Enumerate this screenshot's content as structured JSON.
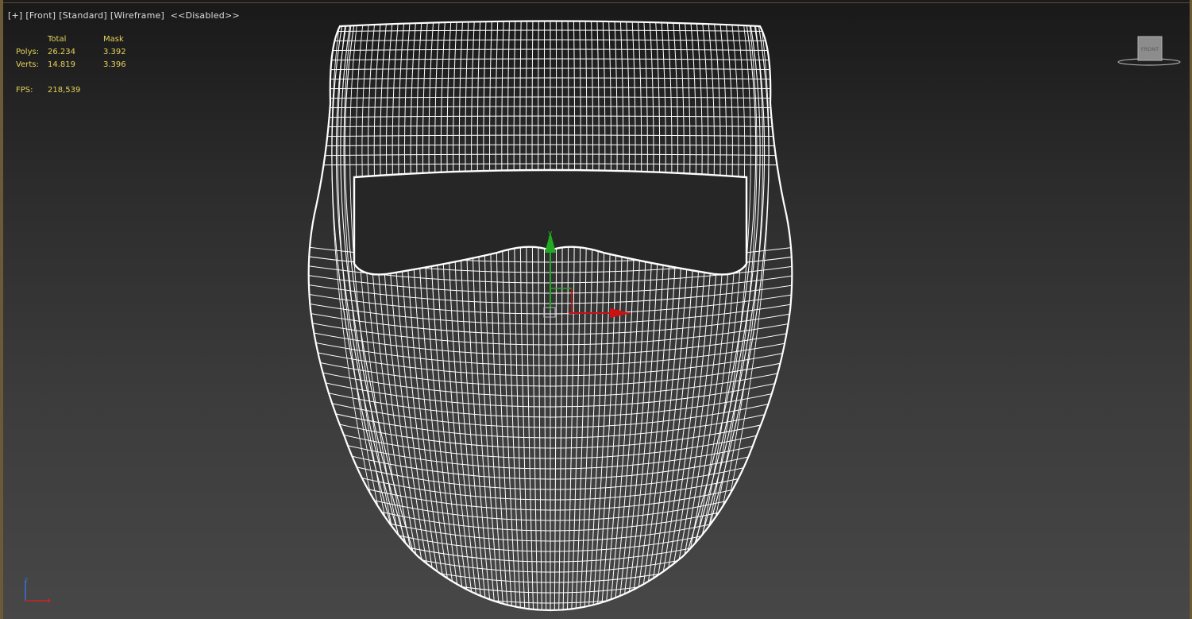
{
  "viewport": {
    "labels": [
      "[+]",
      "[Front]",
      "[Standard]",
      "[Wireframe]",
      "<<Disabled>>"
    ],
    "stats": {
      "header": [
        "",
        "Total",
        "Mask"
      ],
      "rows": [
        {
          "label": "Polys:",
          "total": "26.234",
          "mask": "3.392"
        },
        {
          "label": "Verts:",
          "total": "14.819",
          "mask": "3.396"
        }
      ],
      "fps_label": "FPS:",
      "fps_value": "218,539"
    },
    "viewcube_label": "FRONT",
    "gizmo_y_label": "y",
    "tripod_z_label": "z"
  },
  "colors": {
    "stats_text": "#e6d25a",
    "wire": "#ffffff",
    "gizmo_x": "#cc1111",
    "gizmo_y": "#22aa22",
    "border": "#6b5a35"
  }
}
